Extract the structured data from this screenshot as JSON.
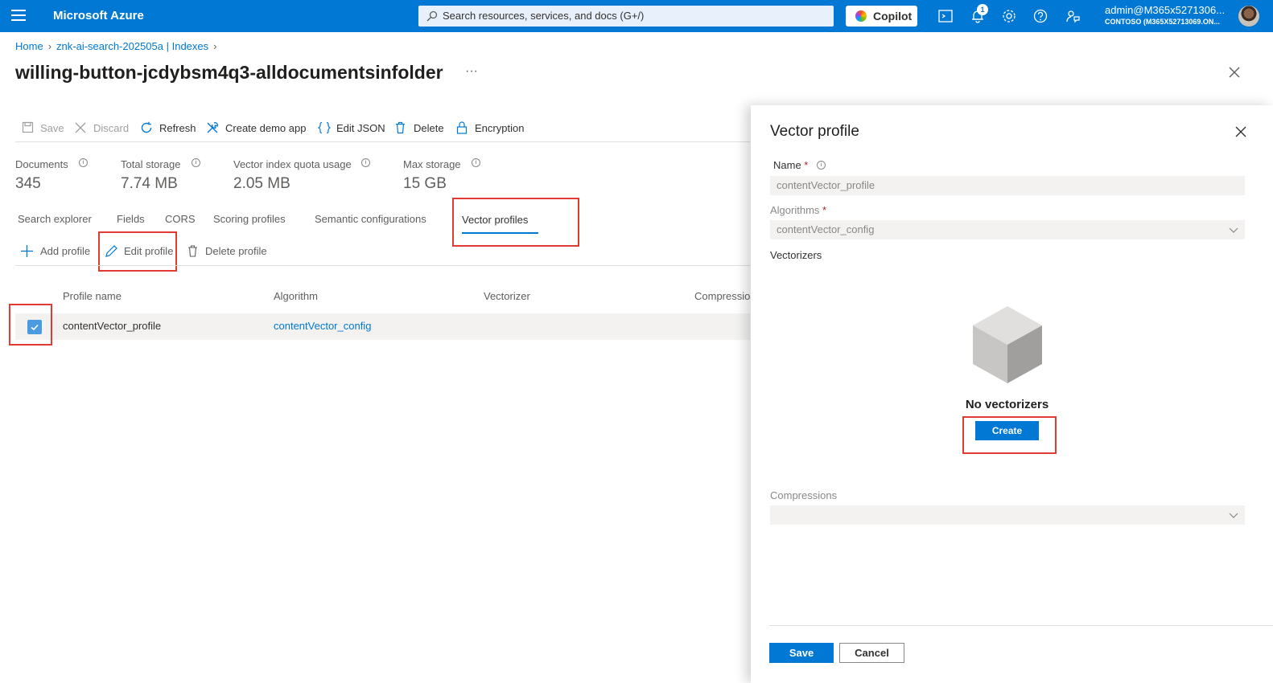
{
  "topbar": {
    "brand": "Microsoft Azure",
    "search_placeholder": "Search resources, services, and docs (G+/)",
    "copilot_label": "Copilot",
    "notification_count": "1",
    "account_user": "admin@M365x5271306...",
    "account_tenant": "CONTOSO (M365X52713069.ON..."
  },
  "breadcrumb": {
    "home": "Home",
    "service": "znk-ai-search-202505a | Indexes"
  },
  "page": {
    "title": "willing-button-jcdybsm4q3-alldocumentsinfolder",
    "more": "···"
  },
  "toolbar": {
    "save": "Save",
    "discard": "Discard",
    "refresh": "Refresh",
    "create_demo": "Create demo app",
    "edit_json": "Edit JSON",
    "delete": "Delete",
    "encryption": "Encryption"
  },
  "stats": [
    {
      "label": "Documents",
      "value": "345"
    },
    {
      "label": "Total storage",
      "value": "7.74 MB"
    },
    {
      "label": "Vector index quota usage",
      "value": "2.05 MB"
    },
    {
      "label": "Max storage",
      "value": "15 GB"
    }
  ],
  "tabs": [
    "Search explorer",
    "Fields",
    "CORS",
    "Scoring profiles",
    "Semantic configurations",
    "Vector profiles"
  ],
  "active_tab": "Vector profiles",
  "profile_actions": {
    "add": "Add profile",
    "edit": "Edit profile",
    "delete": "Delete profile"
  },
  "table": {
    "headers": [
      "Profile name",
      "Algorithm",
      "Vectorizer",
      "Compression"
    ],
    "rows": [
      {
        "name": "contentVector_profile",
        "algorithm": "contentVector_config",
        "vectorizer": "",
        "compression": "",
        "selected": true
      }
    ]
  },
  "panel": {
    "title": "Vector profile",
    "name_label": "Name",
    "name_value": "contentVector_profile",
    "algorithms_label": "Algorithms",
    "algorithms_value": "contentVector_config",
    "vectorizers_label": "Vectorizers",
    "empty_text": "No vectorizers",
    "create_label": "Create",
    "compressions_label": "Compressions",
    "compressions_value": "",
    "save_label": "Save",
    "cancel_label": "Cancel"
  },
  "colors": {
    "accent": "#0078d4",
    "highlight": "#e03c31"
  }
}
